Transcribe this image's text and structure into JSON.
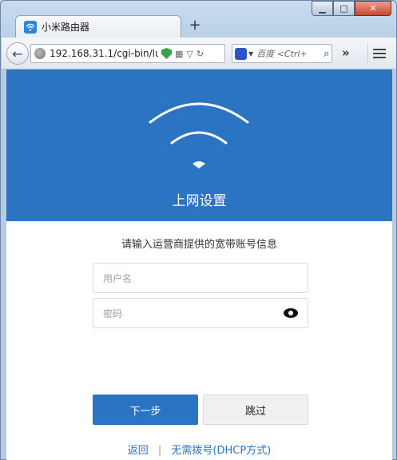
{
  "browser": {
    "tab_title": "小米路由器",
    "new_tab_label": "+",
    "url": "192.168.31.1/cgi-bin/luc",
    "search_placeholder": "百度 <Ctrl+",
    "window_controls": {
      "minimize": "▁",
      "maximize": "□",
      "close": "✕"
    }
  },
  "page": {
    "hero_title": "上网设置",
    "subtitle": "请输入运营商提供的宽带账号信息",
    "username_placeholder": "用户名",
    "password_placeholder": "密码",
    "next_button": "下一步",
    "skip_button": "跳过",
    "footer": {
      "back_link": "返回",
      "separator": "|",
      "dhcp_link": "无需拨号(DHCP方式)"
    }
  },
  "colors": {
    "accent": "#2b74c3",
    "hero_bg": "#2b74c3"
  }
}
